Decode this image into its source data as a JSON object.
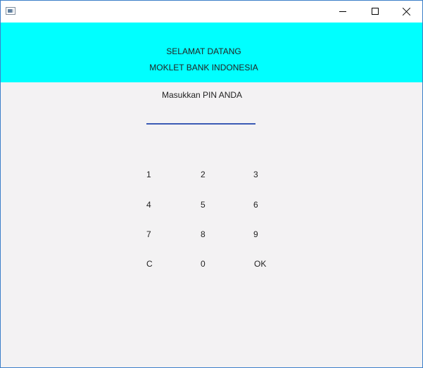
{
  "window": {
    "icon": "app-window-icon",
    "controls": [
      "minimize-icon",
      "maximize-icon",
      "close-icon"
    ]
  },
  "banner": {
    "line1": "SELAMAT DATANG",
    "line2": "MOKLET BANK INDONESIA",
    "color": "#00ffff"
  },
  "pin": {
    "label": "Masukkan PIN ANDA",
    "value": "",
    "underline_color": "#3b5bb5"
  },
  "keypad": {
    "k1": "1",
    "k2": "2",
    "k3": "3",
    "k4": "4",
    "k5": "5",
    "k6": "6",
    "k7": "7",
    "k8": "8",
    "k9": "9",
    "clear": "C",
    "k0": "0",
    "ok": "OK"
  }
}
